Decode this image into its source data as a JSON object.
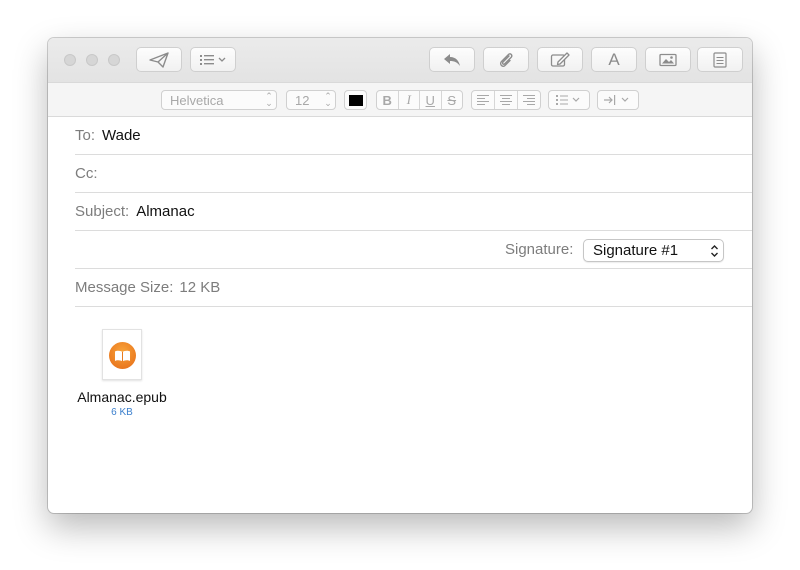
{
  "toolbar": {
    "send_icon": "paper-plane-icon",
    "header_fields_icon": "list-icon",
    "reply_icon": "reply-arrow-icon",
    "attach_icon": "paperclip-icon",
    "markup_icon": "markup-pen-icon",
    "fonts_icon": "font-A-icon",
    "fonts_label": "A",
    "photo_icon": "photo-browser-icon",
    "stationery_icon": "stationery-icon"
  },
  "format": {
    "font_family": "Helvetica",
    "font_size": "12",
    "text_color": "#000000",
    "bold": "B",
    "italic": "I",
    "underline": "U",
    "strikethrough": "S"
  },
  "headers": {
    "to_label": "To:",
    "to_value": "Wade",
    "cc_label": "Cc:",
    "cc_value": "",
    "subject_label": "Subject:",
    "subject_value": "Almanac",
    "signature_label": "Signature:",
    "signature_value": "Signature #1",
    "message_size_label": "Message Size:",
    "message_size_value": "12 KB"
  },
  "attachment": {
    "icon": "ibooks-icon",
    "filename": "Almanac.epub",
    "size": "6 KB"
  },
  "colors": {
    "accent": "#ef8a1e",
    "link_size": "#3b7fcd"
  }
}
